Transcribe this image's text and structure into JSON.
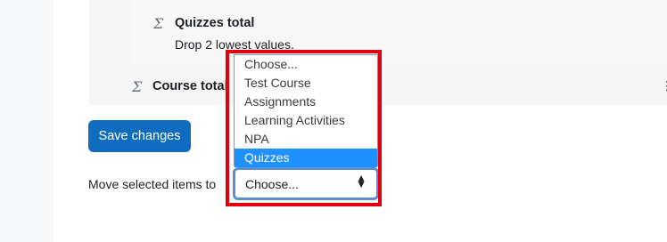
{
  "grader": {
    "quizzes_total": {
      "title": "Quizzes total",
      "description": "Drop 2 lowest values."
    },
    "course_total": {
      "title": "Course total"
    },
    "row_menu_icon": "kebab-menu-icon"
  },
  "form": {
    "save_label": "Save changes",
    "move_label": "Move selected items to",
    "select": {
      "current": "Choose...",
      "options": [
        "Choose...",
        "Test Course",
        "Assignments",
        "Learning Activities",
        "NPA",
        "Quizzes"
      ],
      "highlighted_option": "Quizzes"
    }
  },
  "colors": {
    "primary": "#0f6cbf",
    "highlight_border": "#e2000f",
    "option_selected": "#1e90ff"
  }
}
